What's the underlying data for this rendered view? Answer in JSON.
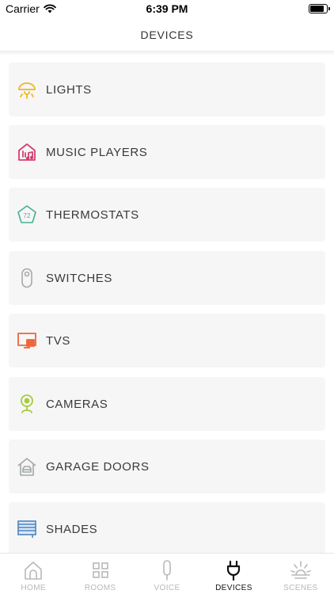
{
  "status_bar": {
    "carrier": "Carrier",
    "time": "6:39 PM",
    "battery_level": 0.9
  },
  "nav": {
    "title": "DEVICES"
  },
  "devices": [
    {
      "label": "LIGHTS",
      "icon": "light-bulb-icon",
      "color": "#f2b51d"
    },
    {
      "label": "MUSIC PLAYERS",
      "icon": "music-house-icon",
      "color": "#d3406f"
    },
    {
      "label": "THERMOSTATS",
      "icon": "thermostat-icon",
      "color": "#45b095",
      "icon_text": "72"
    },
    {
      "label": "SWITCHES",
      "icon": "switch-icon",
      "color": "#a8a8a8"
    },
    {
      "label": "TVS",
      "icon": "tv-icon",
      "color": "#f0643a"
    },
    {
      "label": "CAMERAS",
      "icon": "camera-icon",
      "color": "#a6cc3b"
    },
    {
      "label": "GARAGE DOORS",
      "icon": "garage-icon",
      "color": "#a0a8a8"
    },
    {
      "label": "SHADES",
      "icon": "shades-icon",
      "color": "#4a84c4"
    }
  ],
  "tabs": [
    {
      "label": "HOME",
      "icon": "home-icon",
      "active": false
    },
    {
      "label": "ROOMS",
      "icon": "rooms-grid-icon",
      "active": false
    },
    {
      "label": "VOICE",
      "icon": "microphone-icon",
      "active": false
    },
    {
      "label": "DEVICES",
      "icon": "plug-icon",
      "active": true
    },
    {
      "label": "SCENES",
      "icon": "sunrise-icon",
      "active": false
    }
  ],
  "colors": {
    "row_bg": "#f6f6f6",
    "tab_inactive": "#b8b8b8",
    "tab_active": "#111111"
  }
}
